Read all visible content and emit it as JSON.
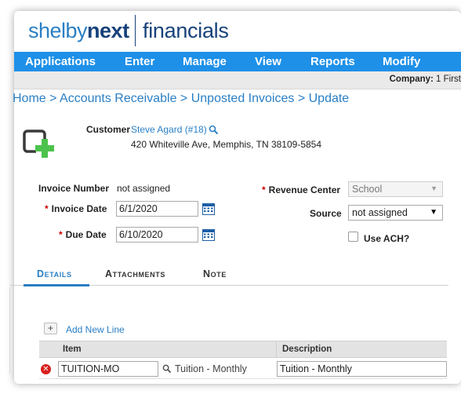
{
  "logo": {
    "brand_part1": "shelby",
    "brand_part2": "next",
    "product": "financials"
  },
  "nav": {
    "items": [
      "Applications",
      "Enter",
      "Manage",
      "View",
      "Reports",
      "Modify"
    ]
  },
  "company": {
    "label": "Company:",
    "value": "1 First"
  },
  "breadcrumb": {
    "items": [
      "Home",
      "Accounts Receivable",
      "Unposted Invoices",
      "Update"
    ],
    "separator": ">"
  },
  "customer": {
    "label": "Customer",
    "name": "Steve Agard (#18)",
    "address": "420 Whiteville Ave, Memphis, TN 38109-5854"
  },
  "form": {
    "invoice_number_label": "Invoice Number",
    "invoice_number_value": "not assigned",
    "invoice_date_label": "Invoice Date",
    "invoice_date_value": "6/1/2020",
    "due_date_label": "Due Date",
    "due_date_value": "6/10/2020",
    "revenue_center_label": "Revenue Center",
    "revenue_center_value": "School",
    "source_label": "Source",
    "source_value": "not assigned",
    "use_ach_label": "Use ACH?",
    "use_ach_checked": false,
    "required_marker": "*"
  },
  "tabs": [
    "Details",
    "Attachments",
    "Note"
  ],
  "lines": {
    "add_label": "Add New Line",
    "add_button_glyph": "+",
    "columns": [
      "Item",
      "Description"
    ],
    "rows": [
      {
        "item": "TUITION-MO",
        "item_lookup": "Tuition - Monthly",
        "description": "Tuition - Monthly"
      }
    ]
  },
  "colors": {
    "nav_bg": "#1e90e8",
    "link": "#2a7fc4",
    "brand_dark": "#17427a",
    "add_icon_green": "#4cc24c",
    "required": "#cc0000"
  }
}
